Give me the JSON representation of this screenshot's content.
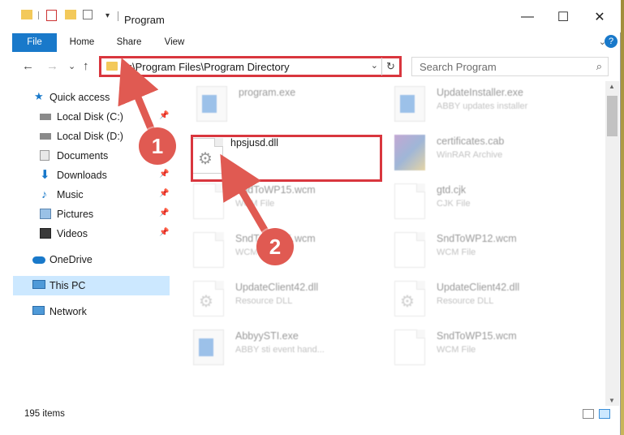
{
  "window": {
    "title": "Program",
    "controls": {
      "minimize": "—",
      "maximize": "☐",
      "close": "✕"
    }
  },
  "ribbon": {
    "tabs": [
      "File",
      "Home",
      "Share",
      "View"
    ],
    "expand_glyph": "⌄",
    "help_glyph": "?"
  },
  "address_bar": {
    "path": "C:\\Program Files\\Program Directory",
    "dropdown_glyph": "⌄",
    "refresh_glyph": "↻"
  },
  "search": {
    "placeholder": "Search Program",
    "icon_glyph": "⌕"
  },
  "navigation": {
    "back": "←",
    "forward": "→",
    "recent": "⌄",
    "up": "↑",
    "items": [
      {
        "label": "Quick access",
        "icon": "star-icon"
      },
      {
        "label": "Local Disk (C:)",
        "icon": "drive-icon",
        "pinned": true
      },
      {
        "label": "Local Disk (D:)",
        "icon": "drive-icon"
      },
      {
        "label": "Documents",
        "icon": "documents-icon",
        "pinned": true
      },
      {
        "label": "Downloads",
        "icon": "downloads-icon",
        "pinned": true
      },
      {
        "label": "Music",
        "icon": "music-icon",
        "pinned": true
      },
      {
        "label": "Pictures",
        "icon": "pictures-icon",
        "pinned": true
      },
      {
        "label": "Videos",
        "icon": "videos-icon",
        "pinned": true
      },
      {
        "label": "OneDrive",
        "icon": "cloud-icon"
      },
      {
        "label": "This PC",
        "icon": "computer-icon",
        "selected": true
      },
      {
        "label": "Network",
        "icon": "network-icon"
      }
    ],
    "pin_glyph": "📌"
  },
  "files": [
    {
      "name": "program.exe",
      "type": "",
      "icon": "exe-icon"
    },
    {
      "name": "UpdateInstaller.exe",
      "type": "ABBY updates installer",
      "icon": "app-icon"
    },
    {
      "name": "hpsjusd.dll",
      "type": "",
      "icon": "dll-gear-icon",
      "highlighted": true
    },
    {
      "name": "certificates.cab",
      "type": "WinRAR Archive",
      "icon": "archive-icon"
    },
    {
      "name": "SndToWP15.wcm",
      "type": "WCM File",
      "icon": "doc-icon"
    },
    {
      "name": "gtd.cjk",
      "type": "CJK File",
      "icon": "doc-icon"
    },
    {
      "name": "SndToWP15.wcm",
      "type": "WCM File",
      "icon": "doc-icon"
    },
    {
      "name": "SndToWP12.wcm",
      "type": "WCM File",
      "icon": "doc-icon"
    },
    {
      "name": "UpdateClient42.dll",
      "type": "Resource DLL",
      "icon": "dll-gear-icon"
    },
    {
      "name": "UpdateClient42.dll",
      "type": "Resource DLL",
      "icon": "dll-gear-icon"
    },
    {
      "name": "AbbyySTI.exe",
      "type": "ABBY sti event hand...",
      "icon": "app-icon"
    },
    {
      "name": "SndToWP15.wcm",
      "type": "WCM File",
      "icon": "doc-icon"
    }
  ],
  "status_bar": {
    "item_count": "195 items"
  },
  "annotations": {
    "step1": "1",
    "step2": "2",
    "color": "#e05a52",
    "box_color": "#d9363e"
  }
}
